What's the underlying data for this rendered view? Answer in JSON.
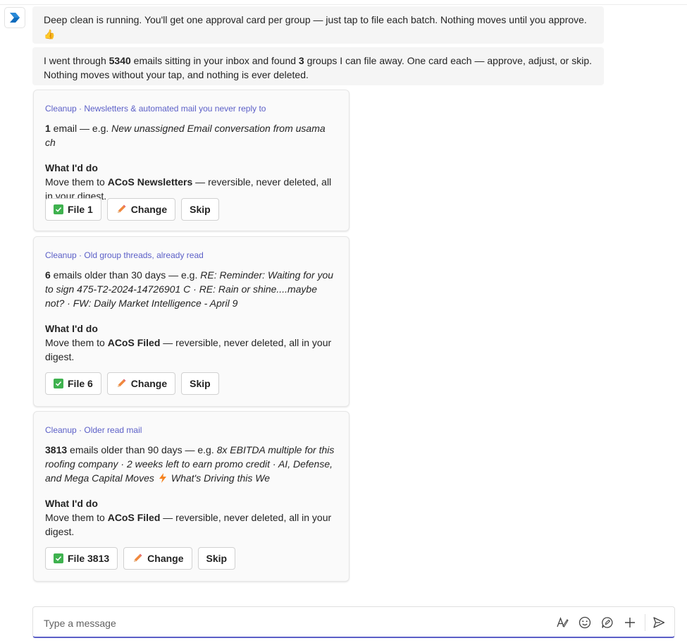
{
  "messages": {
    "m1": {
      "text": "Deep clean is running. You'll get one approval card per group — just tap to file each batch. Nothing moves until you approve.",
      "emoji": "👍"
    },
    "m2": {
      "p1": "I went through ",
      "count": "5340",
      "p2": " emails sitting in your inbox and found ",
      "groups": "3",
      "p3": " groups I can file away. One card each — approve, adjust, or skip. Nothing moves without your tap, and nothing is ever deleted."
    }
  },
  "cards": [
    {
      "header": "Cleanup · Newsletters & automated mail you never reply to",
      "count": "1",
      "desc": " email — e.g. ",
      "examples": "New unassigned Email conversation from usama ch",
      "what_title": "What I'd do",
      "action_pre": "Move them to ",
      "folder": "ACoS Newsletters",
      "action_post": " — reversible, never deleted, all in your digest.",
      "file_label": "File 1",
      "change_label": "Change",
      "skip_label": "Skip"
    },
    {
      "header": "Cleanup · Old group threads, already read",
      "count": "6",
      "desc": " emails older than 30 days — e.g. ",
      "examples": "RE: Reminder: Waiting for you to sign 475-T2-2024-14726901 C · RE: Rain or shine....maybe not? · FW: Daily Market Intelligence - April 9",
      "what_title": "What I'd do",
      "action_pre": "Move them to ",
      "folder": "ACoS Filed",
      "action_post": " — reversible, never deleted, all in your digest.",
      "file_label": "File 6",
      "change_label": "Change",
      "skip_label": "Skip"
    },
    {
      "header": "Cleanup · Older read mail",
      "count": "3813",
      "desc": " emails older than 90 days — e.g. ",
      "examples": "8x EBITDA multiple for this roofing company · 2 weeks left to earn promo credit · AI, Defense, and Mega Capital Moves",
      "examples_tail": "What's Driving this We",
      "what_title": "What I'd do",
      "action_pre": "Move them to ",
      "folder": "ACoS Filed",
      "action_post": " — reversible, never deleted, all in your digest.",
      "file_label": "File 3813",
      "change_label": "Change",
      "skip_label": "Skip"
    }
  ],
  "composer": {
    "placeholder": "Type a message"
  },
  "icons": {
    "bot": "copilot-logo-icon",
    "file": "check-box-icon",
    "change": "pencil-icon",
    "format": "format-icon",
    "emoji": "emoji-icon",
    "loop": "loop-icon",
    "attach": "plus-icon",
    "send": "send-icon"
  },
  "colors": {
    "accent": "#5b5fc7",
    "check": "#3fb24f",
    "bubble": "#f5f5f5"
  }
}
